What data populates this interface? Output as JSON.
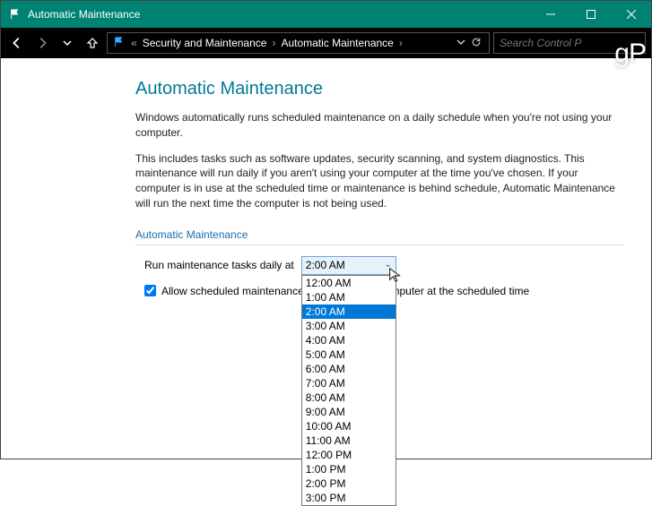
{
  "titlebar": {
    "title": "Automatic Maintenance"
  },
  "breadcrumb": {
    "back_prefix": "«",
    "crumb1": "Security and Maintenance",
    "crumb2": "Automatic Maintenance"
  },
  "search": {
    "placeholder": "Search Control P"
  },
  "page": {
    "heading": "Automatic Maintenance",
    "para1": "Windows automatically runs scheduled maintenance on a daily schedule when you're not using your computer.",
    "para2": "This includes tasks such as software updates, security scanning, and system diagnostics. This maintenance will run daily if you aren't using your computer at the time you've chosen. If your computer is in use at the scheduled time or maintenance is behind schedule, Automatic Maintenance will run the next time the computer is not being used.",
    "section_label": "Automatic Maintenance",
    "run_label": "Run maintenance tasks daily at",
    "selected_time": "2:00 AM",
    "checkbox_label": "Allow scheduled maintenance to wake up my computer at the scheduled time",
    "checkbox_checked": true
  },
  "dropdown_options": [
    "12:00 AM",
    "1:00 AM",
    "2:00 AM",
    "3:00 AM",
    "4:00 AM",
    "5:00 AM",
    "6:00 AM",
    "7:00 AM",
    "8:00 AM",
    "9:00 AM",
    "10:00 AM",
    "11:00 AM",
    "12:00 PM",
    "1:00 PM",
    "2:00 PM",
    "3:00 PM"
  ],
  "watermark": "gP"
}
